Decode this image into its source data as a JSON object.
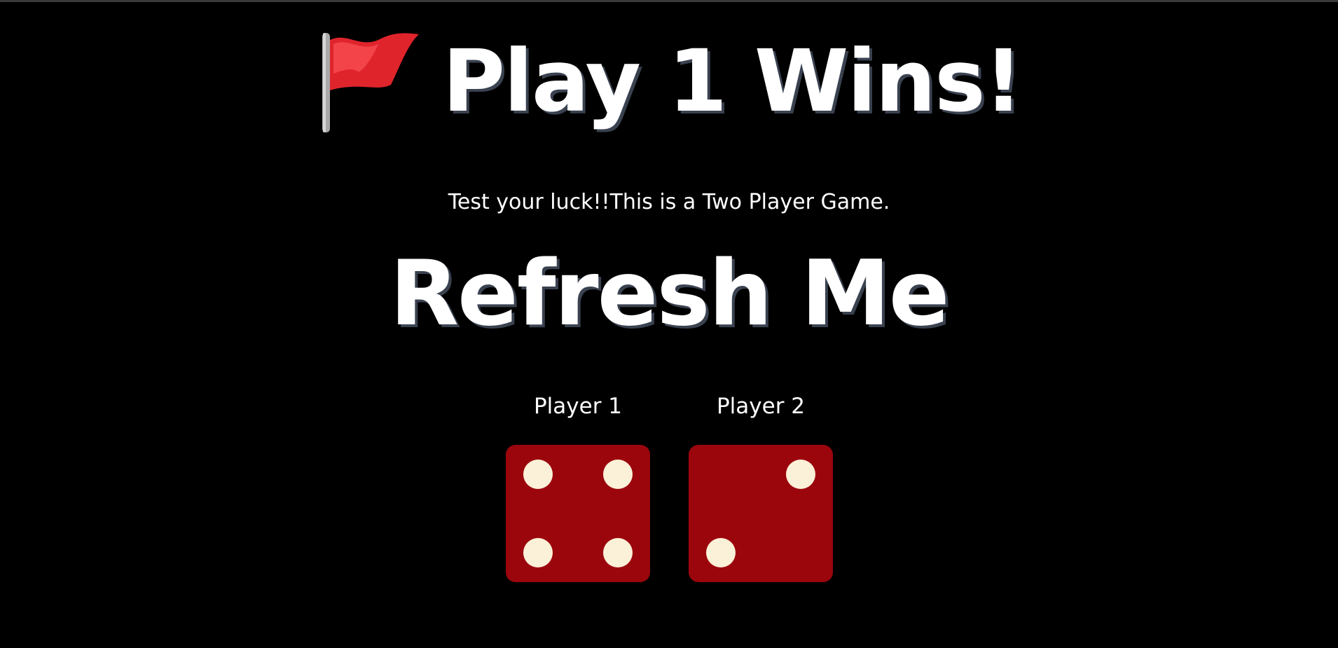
{
  "header": {
    "flag_icon": "red-triangular-flag",
    "title": "Play 1 Wins!"
  },
  "subtitle": "Test your luck!!This is a Two Player Game.",
  "refresh_label": "Refresh Me",
  "players": [
    {
      "label": "Player 1",
      "die_value": 4,
      "die_icon": "dice-four-icon"
    },
    {
      "label": "Player 2",
      "die_value": 2,
      "die_icon": "dice-two-icon"
    }
  ],
  "colors": {
    "background": "#000000",
    "text": "#ffffff",
    "title_shadow": "#3a4250",
    "die_face": "#9b060d",
    "die_pip": "#fbf0d8"
  }
}
